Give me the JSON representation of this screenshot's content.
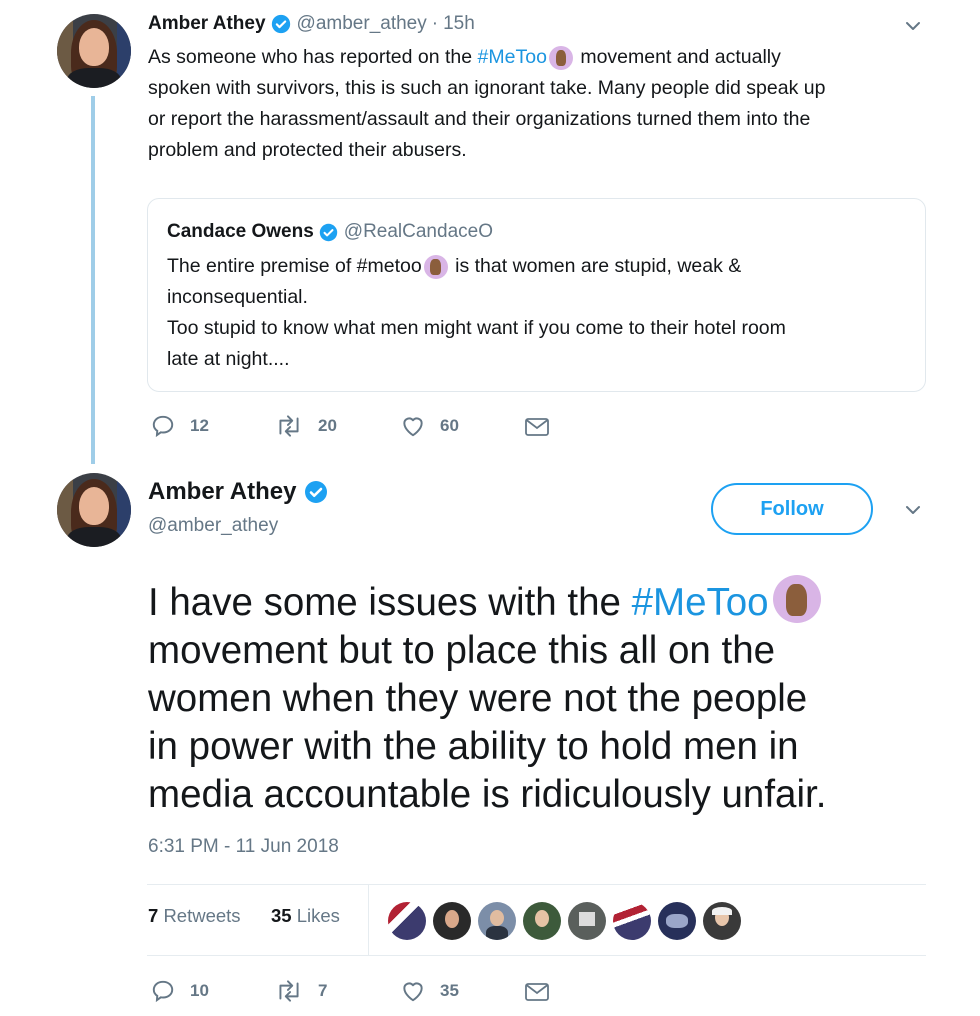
{
  "first_tweet": {
    "author_name": "Amber Athey",
    "handle": "@amber_athey",
    "separator": "·",
    "time": "15h",
    "text_part1": "As someone who has reported on the ",
    "hashtag": "#MeToo",
    "text_line1_rest": " movement and actually",
    "text_line2": "spoken with survivors, this is such an ignorant take. Many people did speak up",
    "text_line3": "or report the harassment/assault and their organizations turned them into the",
    "text_line4": "problem and protected their abusers.",
    "quote": {
      "author_name": "Candace Owens",
      "handle": "@RealCandaceO",
      "line1_prefix": "The entire premise of #metoo",
      "line1_suffix": " is that women are stupid, weak &",
      "line2": "inconsequential.",
      "line3": "Too stupid to know what men might want if you come to their hotel room",
      "line4": "late at night...."
    },
    "actions": {
      "replies": "12",
      "retweets": "20",
      "likes": "60"
    }
  },
  "main_tweet": {
    "author_name": "Amber Athey",
    "handle": "@amber_athey",
    "follow_label": "Follow",
    "text_line1_prefix": "I have some issues with the ",
    "hashtag": "#MeToo",
    "text_line2": "movement but to place this all on the",
    "text_line3": "women when they were not the people",
    "text_line4": "in power with the ability to hold men in",
    "text_line5": "media accountable is ridiculously unfair.",
    "timestamp": "6:31 PM - 11 Jun 2018",
    "stats": {
      "retweets_count": "7",
      "retweets_label": "Retweets",
      "likes_count": "35",
      "likes_label": "Likes"
    },
    "actions": {
      "replies": "10",
      "retweets": "7",
      "likes": "35"
    }
  },
  "colors": {
    "accent": "#1da1f2",
    "hashtag": "#1b95e0",
    "thread_line": "#9fcde8",
    "muted": "#657786"
  },
  "icons": [
    "verified-badge-icon",
    "chevron-down-icon",
    "reply-icon",
    "retweet-icon",
    "like-icon",
    "dm-icon",
    "raised-hands-emoji-icon"
  ]
}
